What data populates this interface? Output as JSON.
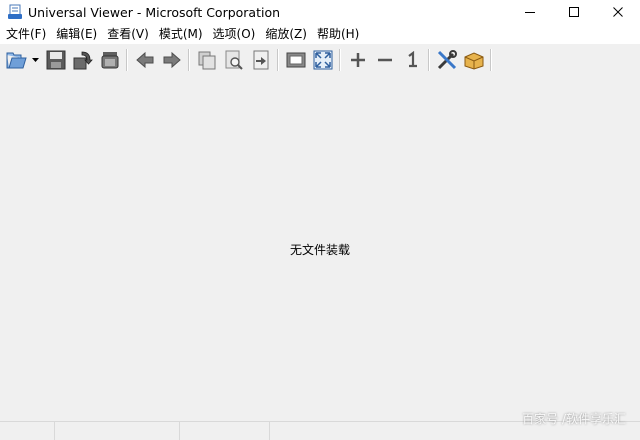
{
  "window": {
    "title": "Universal Viewer - Microsoft Corporation",
    "icon": "document-viewer-icon",
    "controls": [
      "minimize-icon",
      "maximize-icon",
      "close-icon"
    ]
  },
  "menu": {
    "items": [
      {
        "label": "文件(F)"
      },
      {
        "label": "编辑(E)"
      },
      {
        "label": "查看(V)"
      },
      {
        "label": "模式(M)"
      },
      {
        "label": "选项(O)"
      },
      {
        "label": "缩放(Z)"
      },
      {
        "label": "帮助(H)"
      }
    ]
  },
  "toolbar": {
    "buttons": [
      "open-icon",
      "save-icon",
      "reload-icon",
      "print-icon",
      "back-icon",
      "forward-icon",
      "copy-icon",
      "find-icon",
      "goto-icon",
      "fit-window-icon",
      "fullscreen-icon",
      "zoom-in-icon",
      "zoom-out-icon",
      "actual-size-icon",
      "settings-icon",
      "plugins-icon"
    ]
  },
  "content": {
    "message": "无文件装载"
  },
  "watermark": {
    "text": "百家号 /软件享乐汇"
  }
}
